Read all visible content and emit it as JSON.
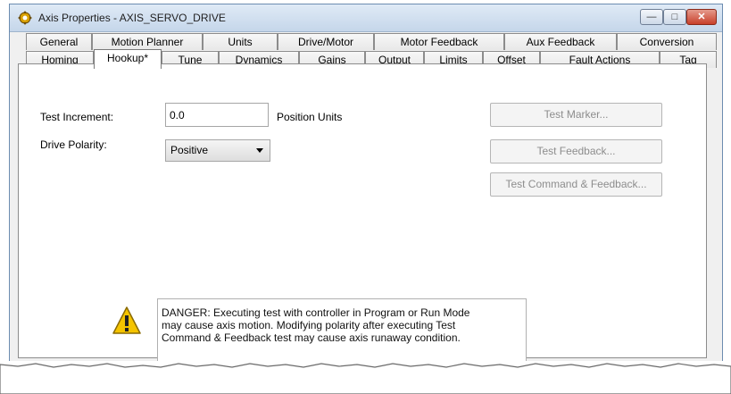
{
  "window": {
    "title": "Axis Properties - AXIS_SERVO_DRIVE",
    "app_icon": "axis-properties-icon",
    "controls": {
      "minimize": "—",
      "maximize": "□",
      "close": "✕"
    }
  },
  "tabs": {
    "row1": [
      "General",
      "Motion Planner",
      "Units",
      "Drive/Motor",
      "Motor Feedback",
      "Aux Feedback",
      "Conversion"
    ],
    "row2": [
      "Homing",
      "Hookup*",
      "Tune",
      "Dynamics",
      "Gains",
      "Output",
      "Limits",
      "Offset",
      "Fault Actions",
      "Tag"
    ],
    "active": "Hookup*"
  },
  "hookup": {
    "test_increment_label": "Test Increment:",
    "test_increment_value": "0.0",
    "position_units_label": "Position Units",
    "drive_polarity_label": "Drive Polarity:",
    "drive_polarity_value": "Positive",
    "test_marker_button": "Test Marker...",
    "test_feedback_button": "Test Feedback...",
    "test_command_feedback_button": "Test Command & Feedback...",
    "danger_line1": "DANGER: Executing test with controller in Program or Run Mode",
    "danger_line2": "may cause axis motion. Modifying polarity after executing Test",
    "danger_line3": "Command & Feedback test may cause axis runaway condition."
  },
  "colors": {
    "warning_icon_fill": "#f5c400",
    "disabled_text": "#8d8d8d"
  }
}
